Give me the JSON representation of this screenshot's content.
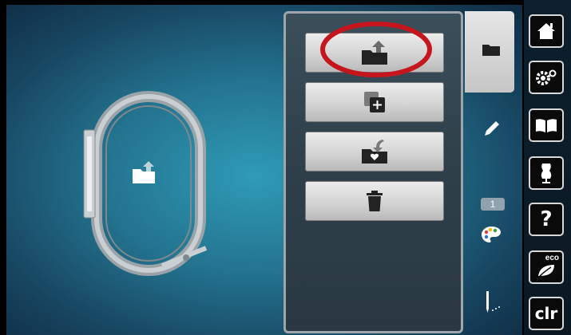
{
  "colors": {
    "highlight": "#c4161c",
    "panel_border": "#9ea6ab",
    "sidebar_bg": "#0d1f2d"
  },
  "canvas": {
    "hoop_icon": "hoop-frame",
    "center_icon": "folder-open-icon"
  },
  "menu": {
    "buttons": [
      {
        "icon": "folder-open-icon"
      },
      {
        "icon": "new-design-icon"
      },
      {
        "icon": "save-favorite-icon"
      },
      {
        "icon": "trash-icon"
      }
    ]
  },
  "tabs": {
    "items": [
      {
        "icon": "folder-icon",
        "active": true
      },
      {
        "icon": "pencil-icon"
      },
      {
        "icon": "color-palette-icon",
        "badge": "1"
      },
      {
        "icon": "needle-stitch-icon"
      }
    ]
  },
  "sidebar": {
    "items": [
      {
        "icon": "home-icon"
      },
      {
        "icon": "settings-icon"
      },
      {
        "icon": "book-icon"
      },
      {
        "icon": "dress-form-icon"
      },
      {
        "icon": "help-icon",
        "label": "?"
      },
      {
        "icon": "eco-leaf-icon",
        "label": "eco"
      },
      {
        "icon": "clear-icon",
        "label": "clr"
      }
    ]
  }
}
